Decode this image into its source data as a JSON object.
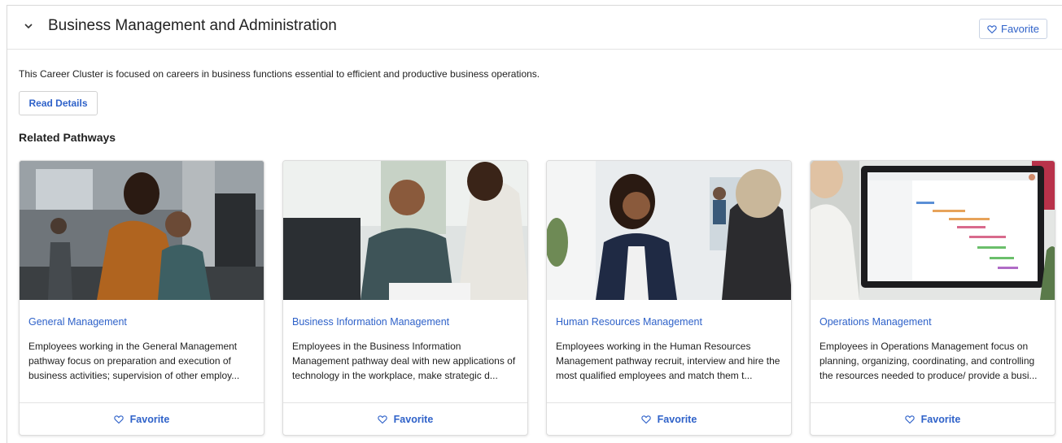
{
  "cluster": {
    "title": "Business Management and Administration",
    "favorite_label": "Favorite",
    "description": "This Career Cluster is focused on careers in business functions essential to efficient and productive business operations.",
    "read_details_label": "Read Details",
    "related_heading": "Related Pathways"
  },
  "pathways": [
    {
      "title": "General Management",
      "text": "Employees working in the General Management pathway focus on preparation and execution of business activities; supervision of other employ...",
      "favorite_label": "Favorite"
    },
    {
      "title": "Business Information Management",
      "text": "Employees in the Business Information Management pathway deal with new applications of technology in the workplace, make strategic d...",
      "favorite_label": "Favorite"
    },
    {
      "title": "Human Resources Management",
      "text": "Employees working in the Human Resources Management pathway recruit, interview and hire the most qualified employees and match them t...",
      "favorite_label": "Favorite"
    },
    {
      "title": "Operations Management",
      "text": "Employees in Operations Management focus on planning, organizing, coordinating, and controlling the resources needed to produce/ provide a busi...",
      "favorite_label": "Favorite"
    }
  ],
  "colors": {
    "link": "#2f62c9",
    "border": "#dcdcdc"
  },
  "icons": {
    "collapse": "chevron-down-icon",
    "favorite": "heart-icon"
  }
}
